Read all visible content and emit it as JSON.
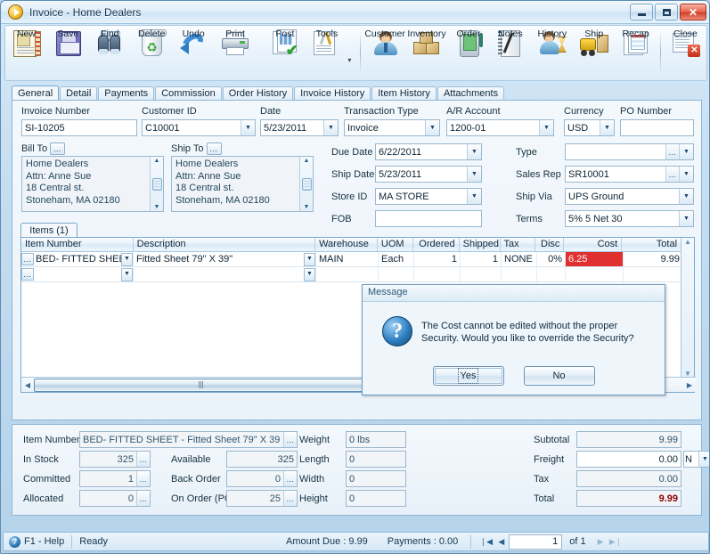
{
  "window": {
    "title": "Invoice - Home Dealers",
    "minimize_label": "Minimize",
    "maximize_label": "Maximize",
    "close_label": "Close"
  },
  "toolbar": {
    "buttons": [
      {
        "label": "New",
        "icon": "new-document-icon"
      },
      {
        "label": "Save",
        "icon": "floppy-disk-icon"
      },
      {
        "label": "Find",
        "icon": "binoculars-icon"
      },
      {
        "label": "Delete",
        "icon": "recycle-bin-icon"
      },
      {
        "label": "Undo",
        "icon": "undo-arrow-icon"
      },
      {
        "label": "Print",
        "icon": "printer-icon"
      },
      {
        "label": "Post",
        "icon": "post-checkmark-icon"
      },
      {
        "label": "Tools",
        "icon": "tools-wrench-icon"
      },
      {
        "label": "Customer",
        "icon": "customer-person-icon"
      },
      {
        "label": "Inventory",
        "icon": "inventory-boxes-icon"
      },
      {
        "label": "Order",
        "icon": "order-device-icon"
      },
      {
        "label": "Notes",
        "icon": "notes-pen-icon"
      },
      {
        "label": "History",
        "icon": "history-hourglass-icon"
      },
      {
        "label": "Ship",
        "icon": "ship-forklift-icon"
      },
      {
        "label": "Recap",
        "icon": "recap-report-icon"
      },
      {
        "label": "Close",
        "icon": "close-window-icon"
      }
    ],
    "tools_caret": "▾"
  },
  "tabs": [
    {
      "label": "General",
      "active": true
    },
    {
      "label": "Detail",
      "active": false
    },
    {
      "label": "Payments",
      "active": false
    },
    {
      "label": "Commission",
      "active": false
    },
    {
      "label": "Order History",
      "active": false
    },
    {
      "label": "Invoice History",
      "active": false
    },
    {
      "label": "Item History",
      "active": false
    },
    {
      "label": "Attachments",
      "active": false
    }
  ],
  "general": {
    "invoice_number_label": "Invoice Number",
    "invoice_number_value": "SI-10205",
    "customer_id_label": "Customer ID",
    "customer_id_value": "C10001",
    "date_label": "Date",
    "date_value": "5/23/2011",
    "transaction_type_label": "Transaction Type",
    "transaction_type_value": "Invoice",
    "ar_account_label": "A/R Account",
    "ar_account_value": "1200-01",
    "currency_label": "Currency",
    "currency_value": "USD",
    "po_number_label": "PO Number",
    "po_number_value": "",
    "bill_to_label": "Bill To",
    "bill_to_value": "Home Dealers\nAttn: Anne Sue\n18 Central st.\nStoneham, MA 02180",
    "ship_to_label": "Ship To",
    "ship_to_value": "Home Dealers\nAttn: Anne Sue\n18 Central st.\nStoneham, MA 02180",
    "due_date_label": "Due Date",
    "due_date_value": "6/22/2011",
    "ship_date_label": "Ship Date",
    "ship_date_value": "5/23/2011",
    "store_id_label": "Store ID",
    "store_id_value": "MA STORE",
    "fob_label": "FOB",
    "fob_value": "",
    "type_label": "Type",
    "type_value": "",
    "sales_rep_label": "Sales Rep",
    "sales_rep_value": "SR10001",
    "ship_via_label": "Ship Via",
    "ship_via_value": "UPS Ground",
    "terms_label": "Terms",
    "terms_value": "5% 5 Net 30",
    "ellipsis": "…"
  },
  "items": {
    "tab_label": "Items (1)",
    "columns": [
      "Item Number",
      "Description",
      "Warehouse",
      "UOM",
      "Ordered",
      "Shipped",
      "Tax",
      "Disc",
      "Cost",
      "Total"
    ],
    "rows": [
      {
        "item_number": "BED- FITTED SHEE",
        "description": "Fitted Sheet 79\" X 39\"",
        "warehouse": "MAIN",
        "uom": "Each",
        "ordered": "1",
        "shipped": "1",
        "tax": "NONE",
        "disc": "0%",
        "cost": "6.25",
        "cost_highlight": "#e03030",
        "total": "9.99"
      },
      {
        "item_number": "",
        "description": "",
        "warehouse": "",
        "uom": "",
        "ordered": "",
        "shipped": "",
        "tax": "",
        "disc": "",
        "cost": "",
        "total": ""
      }
    ]
  },
  "dialog": {
    "title": "Message",
    "icon": "question-mark-icon",
    "message": "The Cost cannot be edited without the proper Security. Would you like to override the Security?",
    "yes_label": "Yes",
    "no_label": "No"
  },
  "detail": {
    "item_number_label": "Item Number",
    "item_number_value": "BED- FITTED SHEET - Fitted Sheet 79\" X 39",
    "in_stock_label": "In Stock",
    "in_stock_value": "325",
    "available_label": "Available",
    "available_value": "325",
    "committed_label": "Committed",
    "committed_value": "1",
    "back_order_label": "Back Order",
    "back_order_value": "0",
    "allocated_label": "Allocated",
    "allocated_value": "0",
    "on_order_label": "On Order (PO)",
    "on_order_value": "25",
    "weight_label": "Weight",
    "weight_value": "0 lbs",
    "length_label": "Length",
    "length_value": "0",
    "width_label": "Width",
    "width_value": "0",
    "height_label": "Height",
    "height_value": "0",
    "subtotal_label": "Subtotal",
    "subtotal_value": "9.99",
    "freight_label": "Freight",
    "freight_value": "0.00",
    "freight_type_value": "N",
    "tax_label": "Tax",
    "tax_value": "0.00",
    "total_label": "Total",
    "total_value": "9.99",
    "total_color": "#8b0000"
  },
  "statusbar": {
    "help_label": "F1 - Help",
    "help_icon": "question-circle-icon",
    "status": "Ready",
    "amount_due": "Amount Due : 9.99",
    "payments": "Payments : 0.00",
    "nav_first": "❘◀",
    "nav_prev": "◀",
    "page_value": "1",
    "of_label": "of 1",
    "nav_next": "▶",
    "nav_last": "▶❘"
  }
}
